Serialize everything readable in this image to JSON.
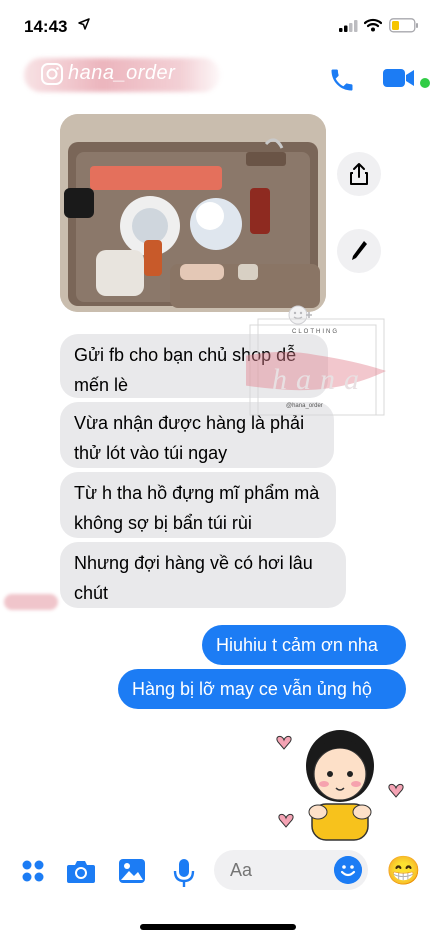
{
  "status": {
    "time": "14:43",
    "icons": [
      "location-arrow-icon",
      "signal-bars-icon",
      "wifi-icon",
      "battery-low-icon"
    ],
    "battery_color": "#f5c400"
  },
  "header": {
    "contact_name": "hana_order",
    "icons": [
      "instagram-icon",
      "phone-icon",
      "video-call-icon"
    ],
    "online": true,
    "accent": "#1c7cf4"
  },
  "messages": {
    "incoming": [
      "Gửi fb cho bạn chủ shop dễ mến lè",
      "Vừa nhận được hàng là phải thử lót vào túi ngay",
      "Từ h tha hồ đựng mĩ phẩm mà không sợ bị bẩn túi rùi",
      "Nhưng đợi hàng về có hơi lâu chút"
    ],
    "outgoing": [
      "Hiuhiu t cảm ơn nha",
      "Hàng bị lỡ may ce vẫn ủng hộ"
    ]
  },
  "watermark": {
    "line1": "CLOTHING",
    "line2": "hana",
    "line3": "@hana_order"
  },
  "toolbar": {
    "icons": [
      "menu-grid-icon",
      "camera-icon",
      "photo-gallery-icon",
      "microphone-icon"
    ],
    "composer_placeholder": "Aa",
    "emoji_button": "smiley-icon",
    "quick_emoji": "😁"
  }
}
